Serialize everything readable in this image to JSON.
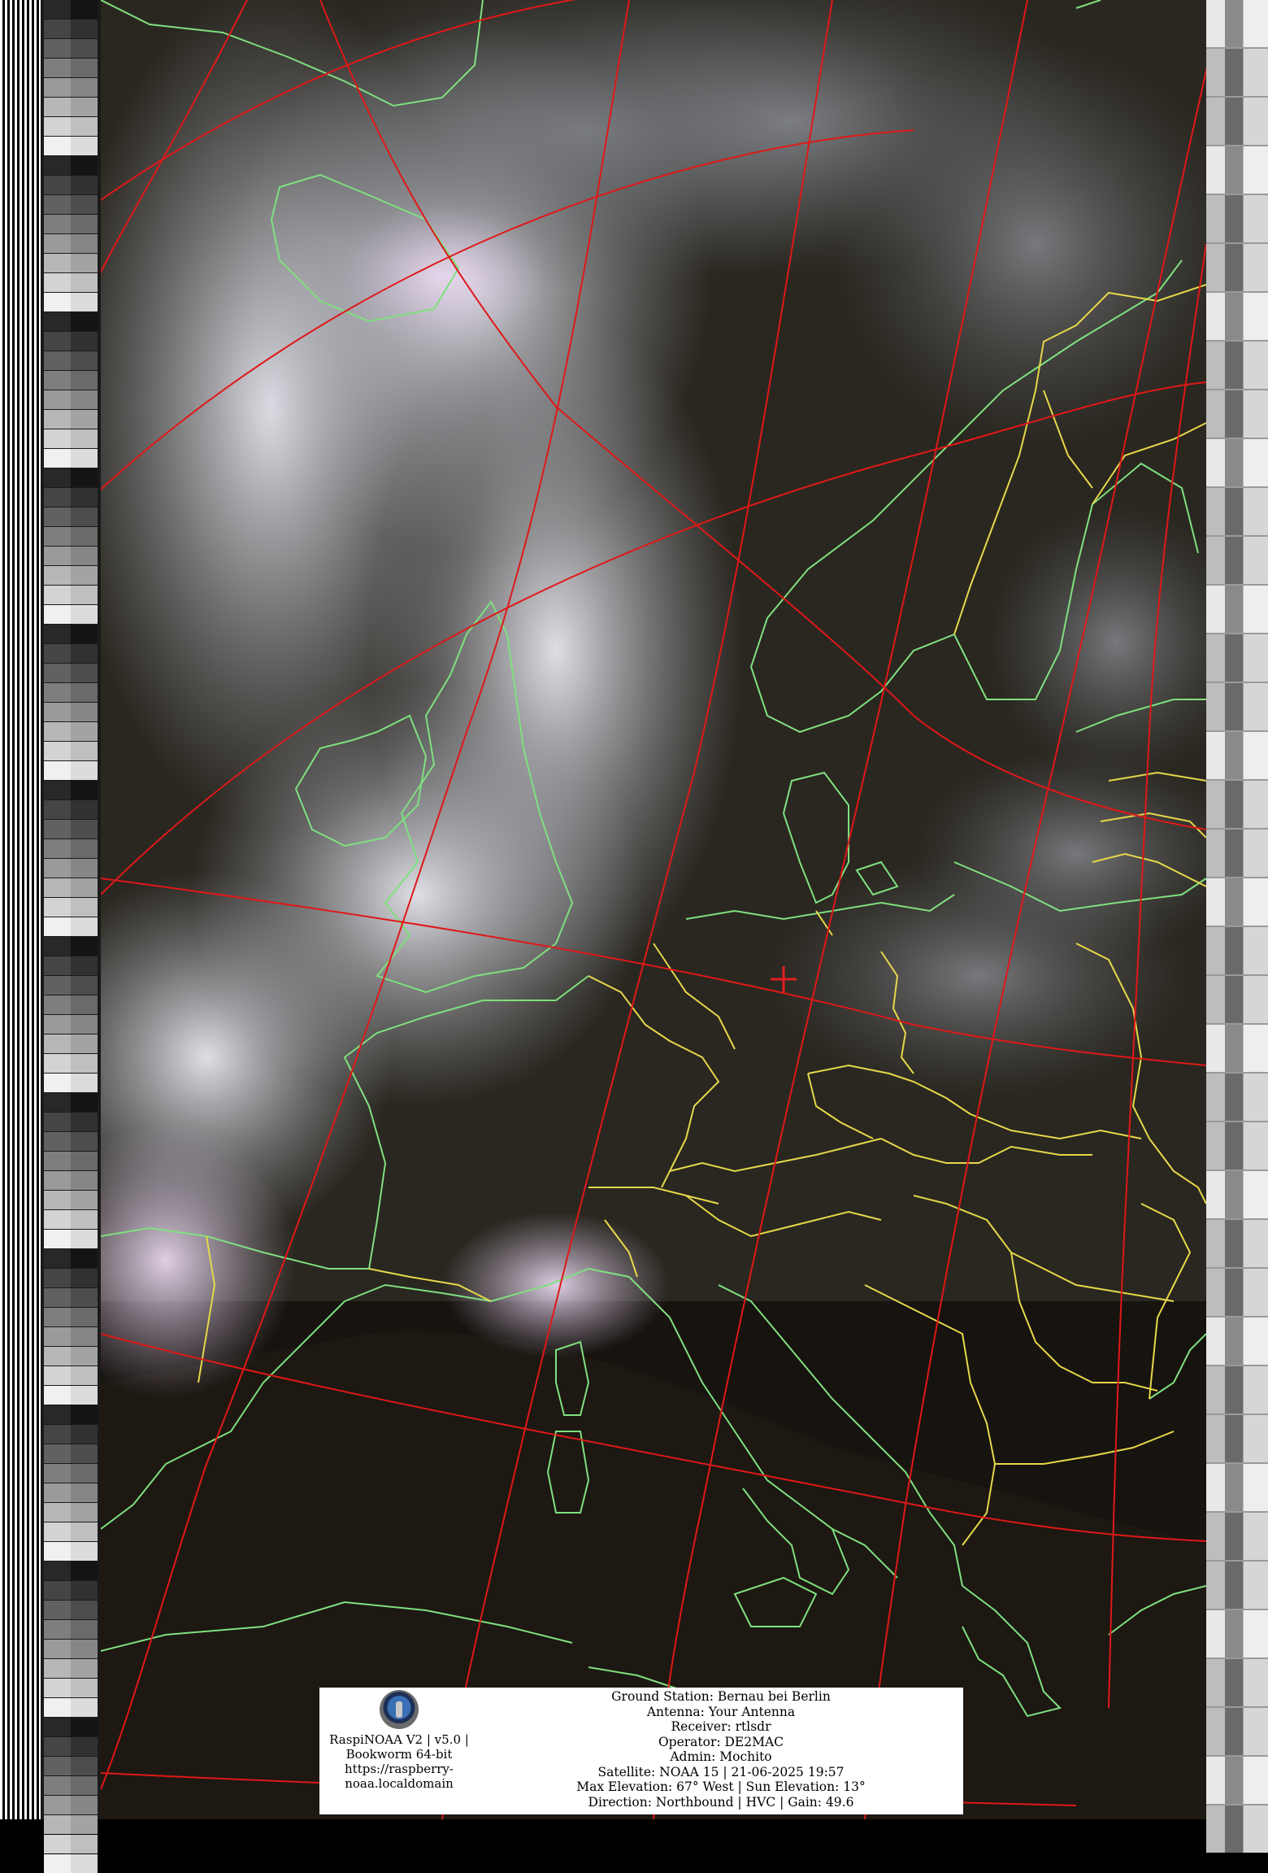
{
  "info_box": {
    "software_line1": "RaspiNOAA V2 | v5.0 |",
    "software_line2": "Bookworm 64-bit",
    "url_line1": "https://raspberry-",
    "url_line2": "noaa.localdomain",
    "ground_station": "Ground Station: Bernau bei Berlin",
    "antenna": "Antenna: Your Antenna",
    "receiver": "Receiver: rtlsdr",
    "operator": "Operator: DE2MAC",
    "admin": "Admin: Mochito",
    "satellite": "Satellite: NOAA 15 | 21-06-2025 19:57",
    "elevation": "Max Elevation: 67° West | Sun Elevation: 13°",
    "direction": "Direction: Northbound | HVC | Gain: 49.6"
  },
  "colors": {
    "coastline": "#7fe07f",
    "borders": "#e6d84a",
    "grid": "#e01818",
    "station_marker": "#e02020"
  }
}
